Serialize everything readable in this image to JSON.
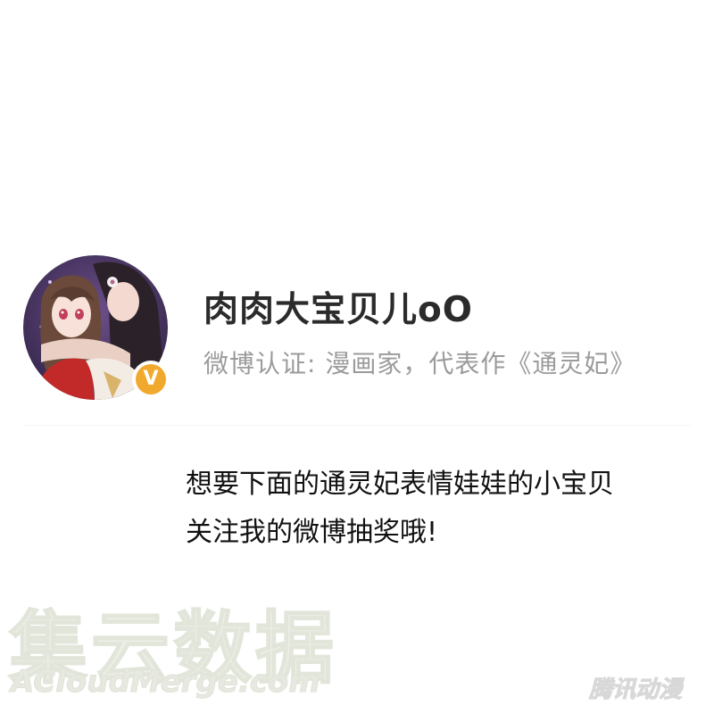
{
  "profile": {
    "username": "肉肉大宝贝儿oO",
    "verification": "微博认证: 漫画家，代表作《通灵妃》",
    "avatar_icon": "anime-couple-avatar",
    "badge_icon": "verified-v-icon",
    "badge_glyph": "V",
    "badge_color": "#f0a92d"
  },
  "message": {
    "line1": "想要下面的通灵妃表情娃娃的小宝贝",
    "line2": "关注我的微博抽奖哦!"
  },
  "watermark": {
    "chinese": "集云数据",
    "english": "ACloudMerge.com",
    "corner_logo": "腾讯动漫"
  }
}
